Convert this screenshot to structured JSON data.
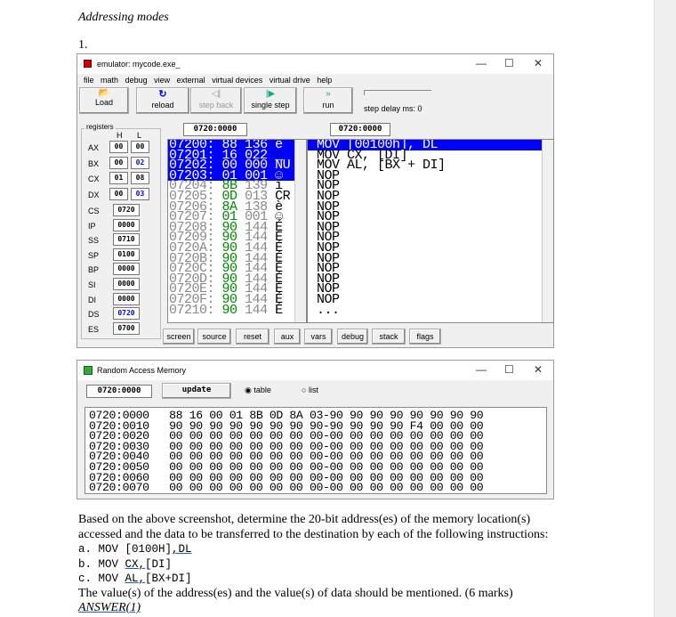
{
  "doc": {
    "heading": "Addressing modes",
    "number": "1.",
    "para1": "Based on the above screenshot, determine the 20-bit address(es) of the memory location(s)",
    "para2": "accessed and the data to be transferred to the destination by each of the following instructions:",
    "qa_prefix": "a. MOV ",
    "qa_rest": "[0100H]",
    "qa_ul": ",DL",
    "qb_prefix": "b. MOV ",
    "qb_ul": "CX,",
    "qb_rest": "[DI]",
    "qc_prefix": "c. MOV ",
    "qc_ul": "AL,",
    "qc_rest": "[BX+DI]",
    "para3": "The value(s) of the address(es) and the value(s) of data should be mentioned. (6 marks)",
    "answer": "ANSWER(1)"
  },
  "emulator": {
    "title": "emulator: mycode.exe_",
    "menu": [
      "file",
      "math",
      "debug",
      "view",
      "external",
      "virtual devices",
      "virtual drive",
      "help"
    ],
    "toolbar": {
      "load": "Load",
      "reload": "reload",
      "step_back": "step back",
      "single_step": "single step",
      "run": "run",
      "step_delay": "step delay ms: 0"
    },
    "addr_left": "0720:0000",
    "addr_right": "0720:0000",
    "registers": {
      "label": "registers",
      "h": "H",
      "l": "L",
      "pairs": [
        {
          "n": "AX",
          "h": "00",
          "l": "00"
        },
        {
          "n": "BX",
          "h": "00",
          "l": "02"
        },
        {
          "n": "CX",
          "h": "01",
          "l": "08"
        },
        {
          "n": "DX",
          "h": "00",
          "l": "03"
        }
      ],
      "single": [
        {
          "n": "CS",
          "v": "0720"
        },
        {
          "n": "IP",
          "v": "0000"
        },
        {
          "n": "SS",
          "v": "0710"
        },
        {
          "n": "SP",
          "v": "0100"
        },
        {
          "n": "BP",
          "v": "0000"
        },
        {
          "n": "SI",
          "v": "0000"
        },
        {
          "n": "DI",
          "v": "0000"
        },
        {
          "n": "DS",
          "v": "0720"
        },
        {
          "n": "ES",
          "v": "0700"
        }
      ]
    },
    "memory": [
      {
        "a": "07200:",
        "h": "88",
        "d": "136",
        "c": "ê"
      },
      {
        "a": "07201:",
        "h": "16",
        "d": "022",
        "c": "_"
      },
      {
        "a": "07202:",
        "h": "00",
        "d": "000",
        "c": "NU"
      },
      {
        "a": "07203:",
        "h": "01",
        "d": "001",
        "c": "☺"
      },
      {
        "a": "07204:",
        "h": "8B",
        "d": "139",
        "c": "ï"
      },
      {
        "a": "07205:",
        "h": "0D",
        "d": "013",
        "c": "CR"
      },
      {
        "a": "07206:",
        "h": "8A",
        "d": "138",
        "c": "è"
      },
      {
        "a": "07207:",
        "h": "01",
        "d": "001",
        "c": "☺"
      },
      {
        "a": "07208:",
        "h": "90",
        "d": "144",
        "c": "É"
      },
      {
        "a": "07209:",
        "h": "90",
        "d": "144",
        "c": "É"
      },
      {
        "a": "0720A:",
        "h": "90",
        "d": "144",
        "c": "É"
      },
      {
        "a": "0720B:",
        "h": "90",
        "d": "144",
        "c": "É"
      },
      {
        "a": "0720C:",
        "h": "90",
        "d": "144",
        "c": "É"
      },
      {
        "a": "0720D:",
        "h": "90",
        "d": "144",
        "c": "É"
      },
      {
        "a": "0720E:",
        "h": "90",
        "d": "144",
        "c": "É"
      },
      {
        "a": "0720F:",
        "h": "90",
        "d": "144",
        "c": "É"
      },
      {
        "a": "07210:",
        "h": "90",
        "d": "144",
        "c": "É"
      }
    ],
    "disasm": [
      "MOV [00100h], DL",
      "MOV CX, [DI]",
      "MOV AL, [BX + DI]",
      "NOP",
      "NOP",
      "NOP",
      "NOP",
      "NOP",
      "NOP",
      "NOP",
      "NOP",
      "NOP",
      "NOP",
      "NOP",
      "NOP",
      "NOP",
      "..."
    ],
    "buttons": [
      "screen",
      "source",
      "reset",
      "aux",
      "vars",
      "debug",
      "stack",
      "flags"
    ]
  },
  "ram": {
    "title": "Random Access Memory",
    "addr": "0720:0000",
    "update": "update",
    "table": "table",
    "list": "list",
    "rows": [
      "0720:0000   88 16 00 01 8B 0D 8A 03-90 90 90 90 90 90 90 90",
      "0720:0010   90 90 90 90 90 90 90 90-90 90 90 90 F4 00 00 00",
      "0720:0020   00 00 00 00 00 00 00 00-00 00 00 00 00 00 00 00",
      "0720:0030   00 00 00 00 00 00 00 00-00 00 00 00 00 00 00 00",
      "0720:0040   00 00 00 00 00 00 00 00-00 00 00 00 00 00 00 00",
      "0720:0050   00 00 00 00 00 00 00 00-00 00 00 00 00 00 00 00",
      "0720:0060   00 00 00 00 00 00 00 00-00 00 00 00 00 00 00 00",
      "0720:0070   00 00 00 00 00 00 00 00-00 00 00 00 00 00 00 00"
    ]
  }
}
